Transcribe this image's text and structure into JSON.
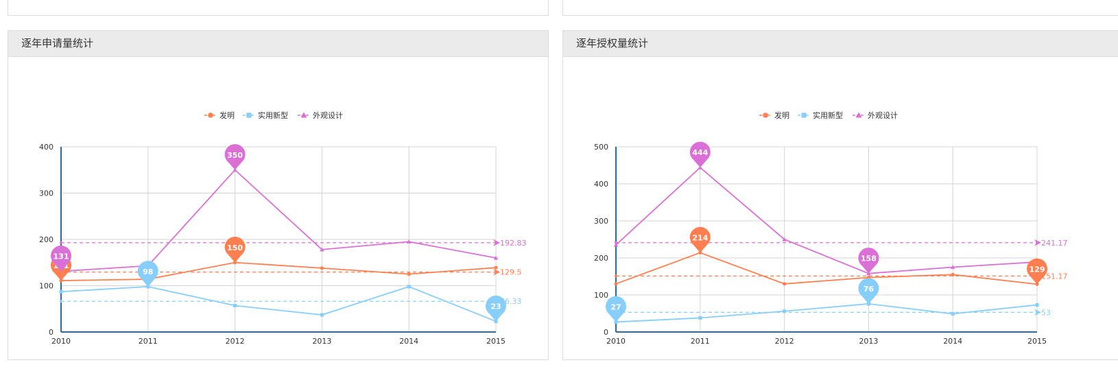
{
  "panels": [
    {
      "title": "逐年申请量统计"
    },
    {
      "title": "逐年授权量统计"
    }
  ],
  "chart_data": [
    {
      "type": "line",
      "title": "逐年申请量统计",
      "legend_position": "top-center",
      "categories": [
        "2010",
        "2011",
        "2012",
        "2013",
        "2014",
        "2015"
      ],
      "ylim": [
        0,
        400
      ],
      "yticks": [
        0,
        100,
        200,
        300,
        400
      ],
      "grid": true,
      "series": [
        {
          "name": "发明",
          "color": "#ff7f50",
          "marker": "circle",
          "values": [
            111,
            114,
            150,
            138,
            125,
            139
          ],
          "average": 129.5,
          "average_label": "129.5",
          "max_pin": {
            "index": 2,
            "value": 150
          },
          "min_pin": {
            "index": 0,
            "value": 111
          }
        },
        {
          "name": "实用新型",
          "color": "#87cefa",
          "marker": "square",
          "values": [
            87,
            98,
            57,
            37,
            98,
            23
          ],
          "average": 66.33,
          "average_label": "66.33",
          "max_pin": {
            "index": 1,
            "value": 98
          },
          "min_pin": {
            "index": 5,
            "value": 23
          }
        },
        {
          "name": "外观设计",
          "color": "#da70d6",
          "marker": "triangle",
          "values": [
            131,
            143,
            350,
            178,
            195,
            160
          ],
          "average": 192.83,
          "average_label": "192.83",
          "max_pin": {
            "index": 2,
            "value": 350
          },
          "min_pin": {
            "index": 0,
            "value": 131
          }
        }
      ]
    },
    {
      "type": "line",
      "title": "逐年授权量统计",
      "legend_position": "top-center",
      "categories": [
        "2010",
        "2011",
        "2012",
        "2013",
        "2014",
        "2015"
      ],
      "ylim": [
        0,
        500
      ],
      "yticks": [
        0,
        100,
        200,
        300,
        400,
        500
      ],
      "grid": true,
      "series": [
        {
          "name": "发明",
          "color": "#ff7f50",
          "marker": "circle",
          "values": [
            130,
            214,
            130,
            147,
            155,
            129
          ],
          "average": 151.17,
          "average_label": "151.17",
          "max_pin": {
            "index": 1,
            "value": 214
          },
          "min_pin": {
            "index": 5,
            "value": 129
          }
        },
        {
          "name": "实用新型",
          "color": "#87cefa",
          "marker": "square",
          "values": [
            27,
            38,
            56,
            76,
            49,
            73
          ],
          "average": 53,
          "average_label": "53",
          "max_pin": {
            "index": 3,
            "value": 76
          },
          "min_pin": {
            "index": 0,
            "value": 27
          }
        },
        {
          "name": "外观设计",
          "color": "#da70d6",
          "marker": "triangle",
          "values": [
            235,
            444,
            250,
            158,
            175,
            189
          ],
          "average": 241.17,
          "average_label": "241.17",
          "max_pin": {
            "index": 1,
            "value": 444
          },
          "min_pin": {
            "index": 3,
            "value": 158
          }
        }
      ]
    }
  ]
}
